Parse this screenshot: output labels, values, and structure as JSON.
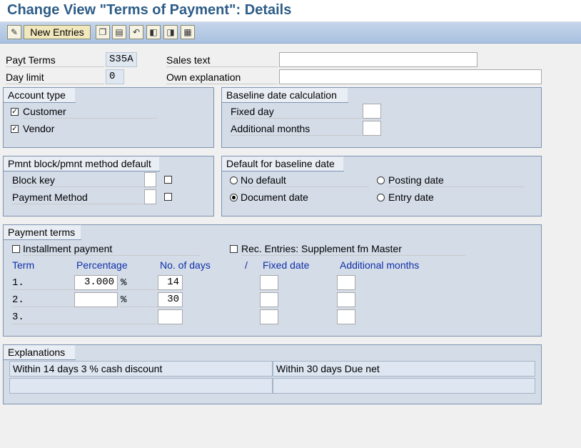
{
  "title": "Change View \"Terms of Payment\": Details",
  "toolbar": {
    "new_entries_label": "New Entries",
    "icons": [
      "edit-display-icon",
      "copy-icon",
      "delete-icon",
      "undo-icon",
      "previous-entry-icon",
      "next-entry-icon",
      "select-all-icon"
    ]
  },
  "header": {
    "payt_terms_label": "Payt Terms",
    "payt_terms_value": "S35A",
    "day_limit_label": "Day limit",
    "day_limit_value": "0",
    "sales_text_label": "Sales text",
    "sales_text_value": "",
    "own_explanation_label": "Own explanation",
    "own_explanation_value": ""
  },
  "account_type": {
    "title": "Account type",
    "customer_label": "Customer",
    "customer_checked": true,
    "vendor_label": "Vendor",
    "vendor_checked": true
  },
  "baseline_calc": {
    "title": "Baseline date calculation",
    "fixed_day_label": "Fixed day",
    "fixed_day_value": "",
    "additional_months_label": "Additional months",
    "additional_months_value": ""
  },
  "pmnt_block": {
    "title": "Pmnt block/pmnt method default",
    "block_key_label": "Block key",
    "payment_method_label": "Payment Method"
  },
  "default_baseline": {
    "title": "Default for baseline date",
    "no_default_label": "No default",
    "posting_date_label": "Posting date",
    "document_date_label": "Document date",
    "entry_date_label": "Entry date",
    "selected": "Document date"
  },
  "payment_terms": {
    "title": "Payment terms",
    "installment_label": "Installment payment",
    "rec_entries_label": "Rec. Entries: Supplement fm Master",
    "columns": {
      "term": "Term",
      "percentage": "Percentage",
      "no_of_days": "No. of days",
      "slash": "/",
      "fixed_date": "Fixed date",
      "additional_months": "Additional months"
    },
    "rows": [
      {
        "term": "1.",
        "percentage": "3.000",
        "pct_sign": "%",
        "days": "14"
      },
      {
        "term": "2.",
        "percentage": "",
        "pct_sign": "%",
        "days": "30"
      },
      {
        "term": "3.",
        "percentage": "",
        "pct_sign": "",
        "days": ""
      }
    ]
  },
  "explanations": {
    "title": "Explanations",
    "line1_left": "Within 14 days 3 % cash discount",
    "line1_right": "Within 30 days Due net",
    "line2_left": "",
    "line2_right": ""
  },
  "colors": {
    "title": "#2d5c88",
    "toolbar": "#b7cbe6",
    "group_bg": "#d4dce8",
    "column_header": "#0f2fa8"
  }
}
